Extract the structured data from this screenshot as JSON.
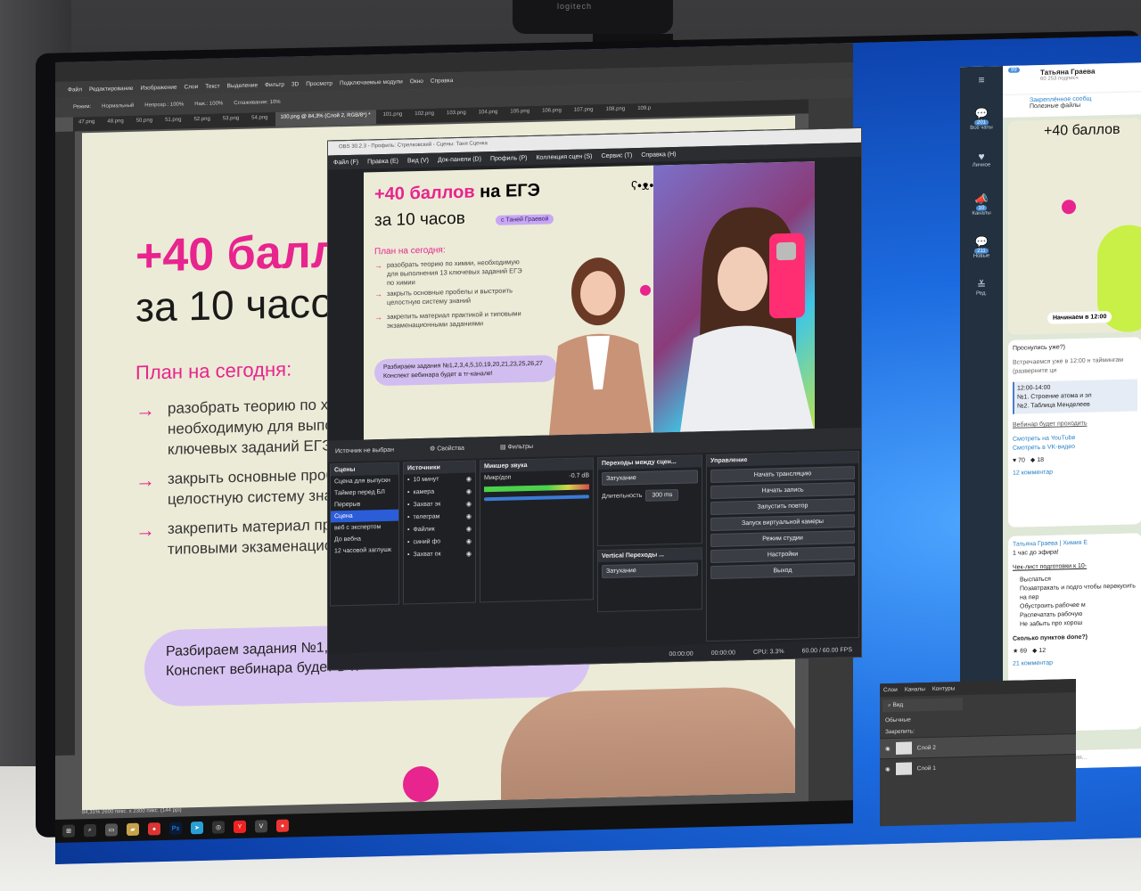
{
  "webcam": {
    "brand": "logitech"
  },
  "photoshop": {
    "menu": [
      "Файл",
      "Редактирование",
      "Изображение",
      "Слои",
      "Текст",
      "Выделение",
      "Фильтр",
      "3D",
      "Просмотр",
      "Подключаемые модули",
      "Окно",
      "Справка"
    ],
    "options": [
      "Режим:",
      "Нормальный",
      "Непрозр.: 100%",
      "Наж.: 100%",
      "Сглаживание: 10%"
    ],
    "tabs": [
      "47.png",
      "48.png",
      "50.png",
      "51.png",
      "52.png",
      "53.png",
      "54.png",
      "100.png @ 84,3% (Слой 2, RGB/8*) *",
      "101.png",
      "102.png",
      "103.png",
      "104.png",
      "105.png",
      "106.png",
      "107.png",
      "108.png",
      "109.p"
    ],
    "active_tab_index": 7,
    "status": "84,31%   2600 пикс. x 2300 пикс. (144 ppi)",
    "canvas": {
      "title": "+40 балл",
      "subtitle": "за 10 часо",
      "plan": "План на сегодня:",
      "items": [
        "разобрать теорию по хим\nнеобходимую для выпол\nключевых заданий ЕГЭ п",
        "закрыть основные пробе\nцелостную систему знан",
        "закрепить материал пра\nтиповыми экзаменацион"
      ],
      "pill": "Разбираем задания №1,2,3,4,5\nКонспект вебинара будет в тг-"
    }
  },
  "obs": {
    "title": "OBS 30.2.3 - Профиль: Стрелковский - Сцены: Таня Сценка",
    "menu": [
      "Файл (F)",
      "Правка (E)",
      "Вид (V)",
      "Док-панели (D)",
      "Профиль (P)",
      "Коллекция сцен (S)",
      "Сервис (T)",
      "Справка (H)"
    ],
    "preview": {
      "title_pink": "+40 баллов",
      "title_black": " на ЕГЭ",
      "subtitle": "за 10 часов",
      "badge": "с Таней Граевой",
      "plan": "План на сегодня:",
      "items": [
        "разобрать теорию по химии, необходимую для выполнения 13 ключевых заданий ЕГЭ по химии",
        "закрыть основные пробелы и выстроить целостную систему знаний",
        "закрепить материал практикой и типовыми экзаменационными заданиями"
      ],
      "pill": "Разбираем задания №1,2,3,4,5,10,19,20,21,23,25,26,27 Конспект вебинара будет в тг-канале!"
    },
    "source_bar": {
      "no_source": "Источник не выбран",
      "properties": "Свойства",
      "filters": "Фильтры"
    },
    "scenes": {
      "header": "Сцены",
      "items": [
        "Сцена для выпускн",
        "Таймер перед БЛ",
        "Перерыв",
        "Сцена",
        "веб с экспертом",
        "До вебна",
        "12 часовой заглушк"
      ],
      "selected_index": 3
    },
    "sources": {
      "header": "Источники",
      "items": [
        "10 минут",
        "камера",
        "Захват эк",
        "телеграм",
        "Файлик",
        "синий фо",
        "Захват ок"
      ]
    },
    "mixer": {
      "header": "Микшер звука",
      "channel": "Микр/доп",
      "level": "-0.7 dB"
    },
    "transitions": {
      "header": "Переходы между сцен...",
      "type": "Затухание",
      "duration_label": "Длительность",
      "duration": "300 ms"
    },
    "vertical": {
      "header": "Vertical Переходы ...",
      "type": "Затухание"
    },
    "controls": {
      "header": "Управление",
      "buttons": [
        "Начать трансляцию",
        "Начать запись",
        "Запустить повтор",
        "Запуск виртуальной камеры",
        "Режим студии",
        "Настройки",
        "Выход"
      ]
    },
    "status": {
      "rec_time": "00:00:00",
      "stream_time": "00:00:00",
      "cpu": "CPU: 3.3%",
      "fps": "60.00 / 60.00 FPS"
    }
  },
  "telegram": {
    "channel_name": "Татьяна Граева",
    "subscribers": "60 253 подписч",
    "pinned_title": "Закреплённое сообщ",
    "pinned_sub": "Полезные файлы",
    "sidebar": [
      {
        "label": "Все чаты",
        "badge": "201"
      },
      {
        "label": "Личное",
        "badge": ""
      },
      {
        "label": "Каналы",
        "badge": "10"
      },
      {
        "label": "Новые",
        "badge": "211"
      },
      {
        "label": "Ред.",
        "badge": ""
      }
    ],
    "unread": "99",
    "post_title": "+40 баллов",
    "starts": "Начинаем в 12:00",
    "msg1": {
      "q": "Проснулись уже?)",
      "body": "Встречаемся уже в 12:00 н таймингам (разверните ци",
      "time": "12:00-14:00",
      "lines": [
        "№1. Строение атома и эл",
        "№2. Таблица Менделеев"
      ],
      "webinar": "Вебинар будет проходить",
      "yt": "Смотреть на YouTube",
      "vk": "Смотреть в VK-видео",
      "reactions": [
        "70",
        "18"
      ],
      "comments": "12 комментар"
    },
    "msg2": {
      "author": "Татьяна Граева | Химия Е",
      "sub": "1 час до эфира!",
      "checklist_title": "Чек-лист подготовки к 10-",
      "checklist": [
        "Выспаться",
        "Позавтракать и подго чтобы перекусить на пер",
        "Обустроить рабочее м",
        "Распечатать рабочую",
        "Не забыть про хорош"
      ],
      "question": "Сколько пунктов done?)",
      "reactions": [
        "69",
        "12"
      ],
      "comments": "21 комментар"
    },
    "input_placeholder": "Тихая публикация..."
  },
  "layers": {
    "tabs": [
      "Слои",
      "Каналы",
      "Контуры"
    ],
    "search": "Вид",
    "mode": "Обычные",
    "lock": "Закрепить:",
    "items": [
      "Слой 2",
      "Слой 1"
    ]
  },
  "colors": {
    "pink": "#e8248e",
    "lime": "#c9f047",
    "lilac": "#d2bdf0",
    "obs_select": "#2c5dd8",
    "win_blue": "#1c6be0"
  }
}
